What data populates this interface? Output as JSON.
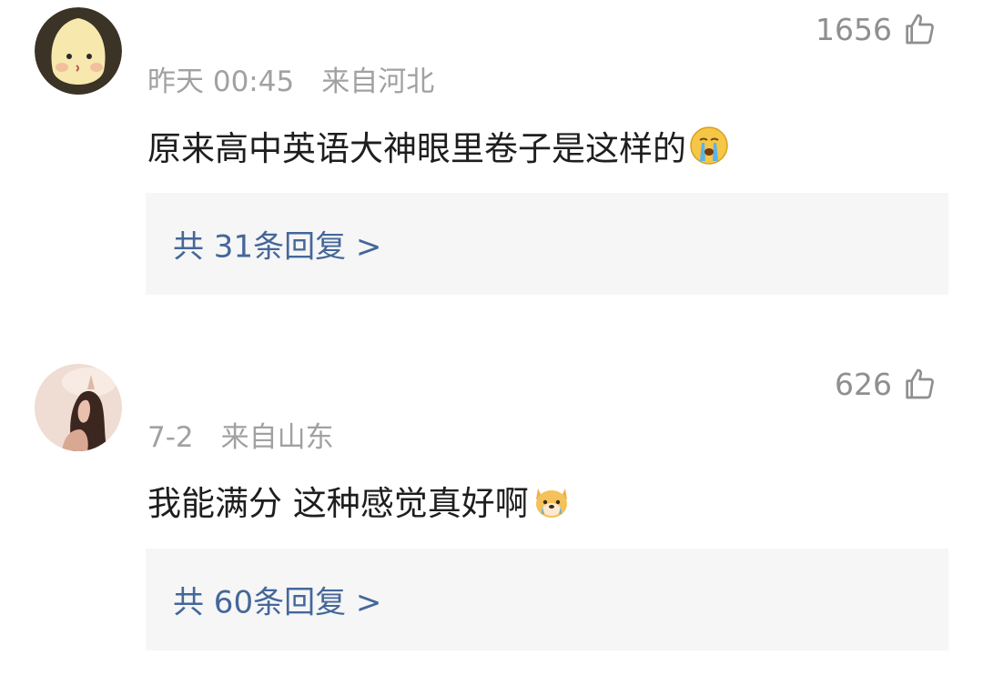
{
  "comments": [
    {
      "avatar_icon": "cartoon-face-avatar",
      "likes": "1656",
      "like_icon": "thumbs-up-outline-icon",
      "time": "昨天 00:45",
      "location": "来自河北",
      "text": "原来高中英语大神眼里卷子是这样的",
      "emoji": "crying-face-emoji",
      "replies": "共 31条回复 >"
    },
    {
      "avatar_icon": "photo-avatar",
      "likes": "626",
      "like_icon": "thumbs-up-outline-icon",
      "time": "7-2",
      "location": "来自山东",
      "text": "我能满分 这种感觉真好啊",
      "emoji": "dog-emoji",
      "replies": "共 60条回复 >"
    }
  ],
  "colors": {
    "meta": "#a1a1a1",
    "text": "#1e1e1e",
    "link": "#44679a",
    "reply_bg": "#f6f6f6"
  }
}
